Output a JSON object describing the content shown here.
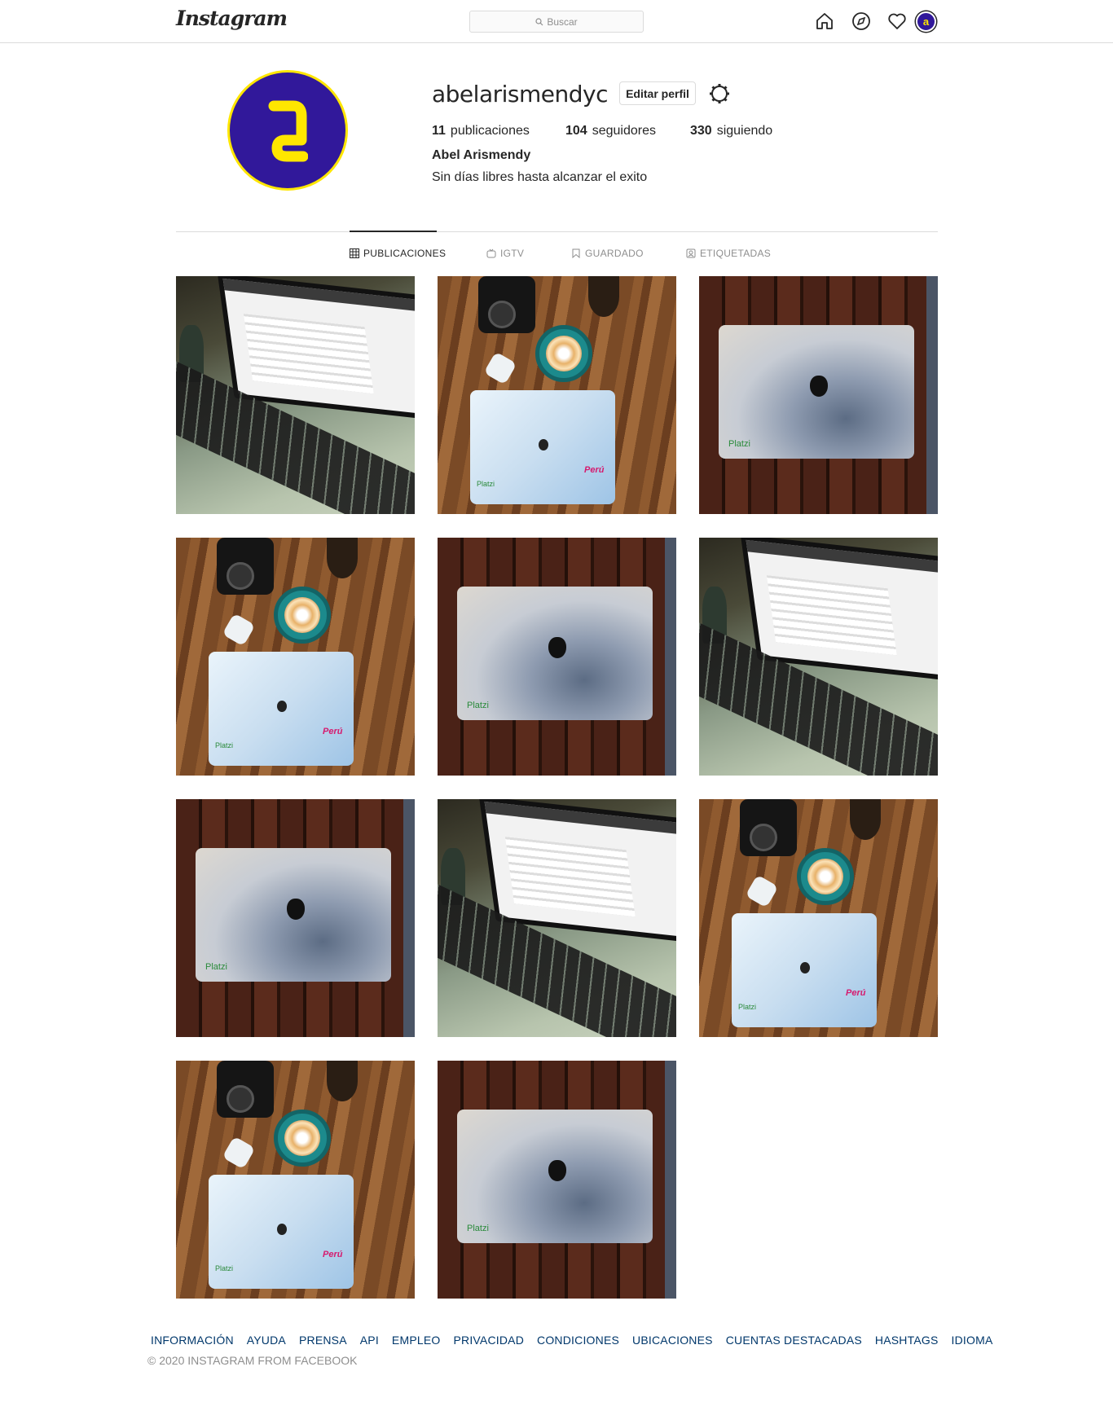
{
  "header": {
    "logo": "Instagram",
    "search_placeholder": "Buscar",
    "icons": [
      "home-icon",
      "explore-icon",
      "heart-icon",
      "profile-avatar"
    ],
    "avatar_glyph": "a"
  },
  "profile": {
    "username": "abelarismendyc",
    "edit_label": "Editar perfil",
    "stats": [
      {
        "count": "11",
        "label": "publicaciones"
      },
      {
        "count": "104",
        "label": "seguidores"
      },
      {
        "count": "330",
        "label": "siguiendo"
      }
    ],
    "full_name": "Abel Arismendy",
    "bio": "Sin días libres hasta alcanzar el exito",
    "avatar_colors": {
      "bg": "#31189a",
      "accent": "#ffe600"
    }
  },
  "tabs": [
    {
      "label": "PUBLICACIONES",
      "icon": "grid-icon",
      "active": true
    },
    {
      "label": "IGTV",
      "icon": "igtv-icon",
      "active": false
    },
    {
      "label": "GUARDADO",
      "icon": "bookmark-icon",
      "active": false
    },
    {
      "label": "ETIQUETADAS",
      "icon": "tagged-icon",
      "active": false
    }
  ],
  "posts": [
    {
      "type": "screen"
    },
    {
      "type": "desk"
    },
    {
      "type": "lid"
    },
    {
      "type": "desk"
    },
    {
      "type": "lid"
    },
    {
      "type": "screen"
    },
    {
      "type": "lid"
    },
    {
      "type": "screen"
    },
    {
      "type": "desk"
    },
    {
      "type": "desk"
    },
    {
      "type": "lid"
    }
  ],
  "post_labels": {
    "platzi": "Platzi",
    "peru": "Perú"
  },
  "footer": {
    "links": [
      "INFORMACIÓN",
      "AYUDA",
      "PRENSA",
      "API",
      "EMPLEO",
      "PRIVACIDAD",
      "CONDICIONES",
      "UBICACIONES",
      "CUENTAS DESTACADAS",
      "HASHTAGS",
      "IDIOMA"
    ],
    "copyright": "© 2020 INSTAGRAM FROM FACEBOOK"
  }
}
